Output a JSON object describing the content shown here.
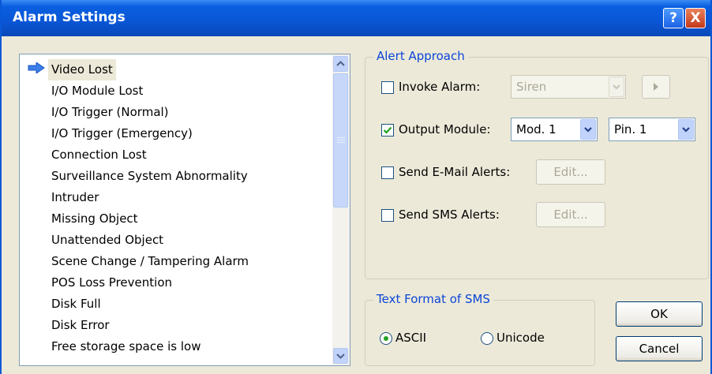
{
  "window": {
    "title": "Alarm Settings"
  },
  "titlebar_buttons": {
    "help": "?",
    "close": "X"
  },
  "events": {
    "items": [
      "Video Lost",
      "I/O Module Lost",
      "I/O Trigger (Normal)",
      "I/O Trigger (Emergency)",
      "Connection Lost",
      "Surveillance System Abnormality",
      "Intruder",
      "Missing Object",
      "Unattended Object",
      "Scene Change / Tampering Alarm",
      "POS Loss Prevention",
      "Disk Full",
      "Disk Error",
      "Free storage space is low"
    ],
    "selected": "Video Lost"
  },
  "alert_approach": {
    "legend": "Alert Approach",
    "invoke_alarm": {
      "label": "Invoke Alarm:",
      "checked": false,
      "sound": "Siren"
    },
    "output_module": {
      "label": "Output Module:",
      "checked": true,
      "module": "Mod. 1",
      "pin": "Pin. 1"
    },
    "email": {
      "label": "Send E-Mail Alerts:",
      "checked": false,
      "button": "Edit..."
    },
    "sms": {
      "label": "Send SMS Alerts:",
      "checked": false,
      "button": "Edit..."
    }
  },
  "sms_format": {
    "legend": "Text Format of SMS",
    "options": [
      "ASCII",
      "Unicode"
    ],
    "selected": "ASCII"
  },
  "buttons": {
    "ok": "OK",
    "cancel": "Cancel"
  },
  "icons": {
    "selected_marker": "arrow-right-icon",
    "play": "play-icon",
    "dropdown": "chevron-down-icon",
    "scroll_up": "chevron-up-icon",
    "scroll_down": "chevron-down-icon"
  },
  "colors": {
    "titlebar": "#0a56d5",
    "dialog_bg": "#ece9d8",
    "legend_text": "#0b45d8",
    "check_green": "#21a121"
  }
}
